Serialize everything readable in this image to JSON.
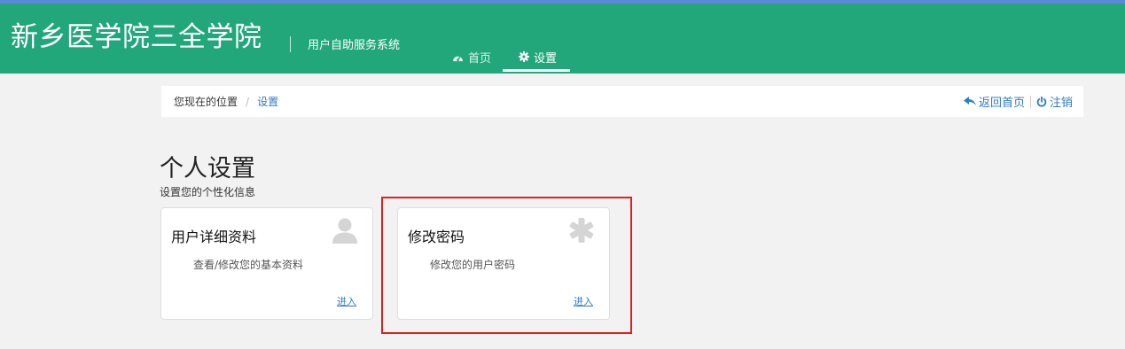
{
  "header": {
    "brand": "新乡医学院三全学院",
    "subtitle": "用户自助服务系统",
    "nav": [
      {
        "label": "首页",
        "icon": "dashboard-icon",
        "active": false
      },
      {
        "label": "设置",
        "icon": "gear-icon",
        "active": true
      }
    ],
    "colors": {
      "header_bg": "#22a77b",
      "top_strip": "#5b86d9",
      "link": "#2f7bc6",
      "highlight": "#e0201f"
    }
  },
  "breadcrumb": {
    "prefix": "您现在的位置",
    "separator": "/",
    "current": "设置",
    "actions": [
      {
        "label": "返回首页",
        "icon": "reply-arrow-icon"
      },
      {
        "label": "注销",
        "icon": "power-icon"
      }
    ]
  },
  "page": {
    "title": "个人设置",
    "subtitle": "设置您的个性化信息"
  },
  "cards": [
    {
      "title": "用户详细资料",
      "description": "查看/修改您的基本资料",
      "link": "进入",
      "icon": "user-icon"
    },
    {
      "title": "修改密码",
      "description": "修改您的用户密码",
      "link": "进入",
      "icon": "asterisk-icon",
      "highlighted": true
    }
  ]
}
